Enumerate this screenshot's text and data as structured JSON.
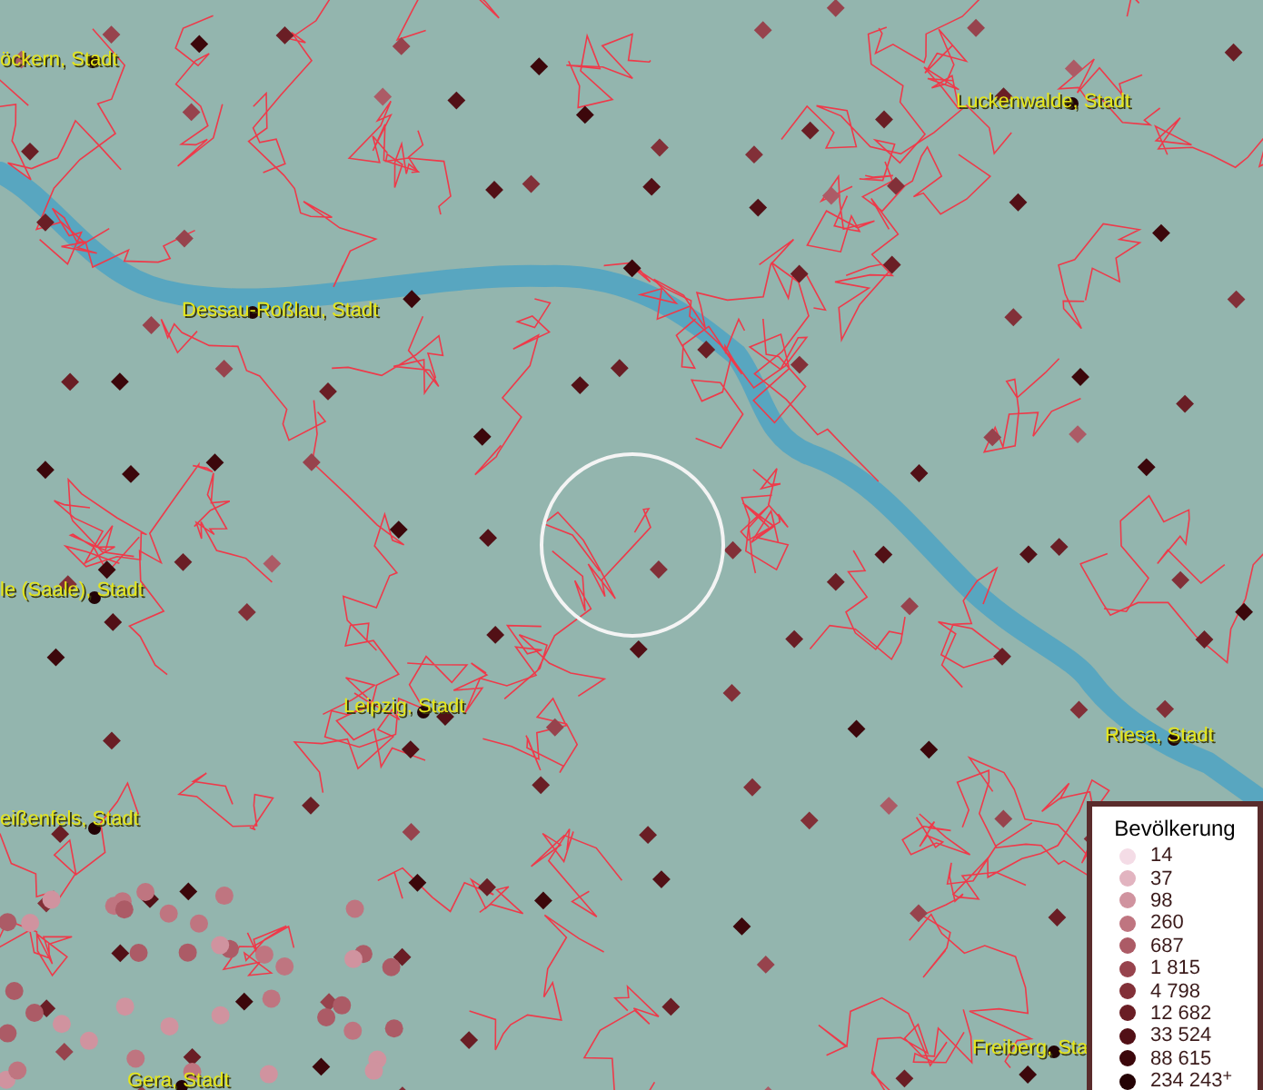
{
  "map": {
    "place_labels": [
      "öckern, Stadt",
      "Luckenwalde, Stadt",
      "Dessau-Roßlau, Stadt",
      "le (Saale), Stadt",
      "Leipzig, Stadt",
      "eißenfels, Stadt",
      "Riesa, Stadt",
      "Gera, Stadt",
      "Freiberg, Sta"
    ]
  },
  "legend": {
    "title": "Bevölkerung",
    "items": [
      {
        "label": "14",
        "color": "#f4dce6"
      },
      {
        "label": "37",
        "color": "#e2b4c0"
      },
      {
        "label": "98",
        "color": "#d0939f"
      },
      {
        "label": "260",
        "color": "#bf7580"
      },
      {
        "label": "687",
        "color": "#ac5b66"
      },
      {
        "label": "1 815",
        "color": "#97434d"
      },
      {
        "label": "4 798",
        "color": "#823038"
      },
      {
        "label": "12 682",
        "color": "#6a1e25"
      },
      {
        "label": "33 524",
        "color": "#521016"
      },
      {
        "label": "88 615",
        "color": "#3c070b"
      },
      {
        "label": "234 243$^{+}$",
        "color": "#250305"
      }
    ]
  }
}
